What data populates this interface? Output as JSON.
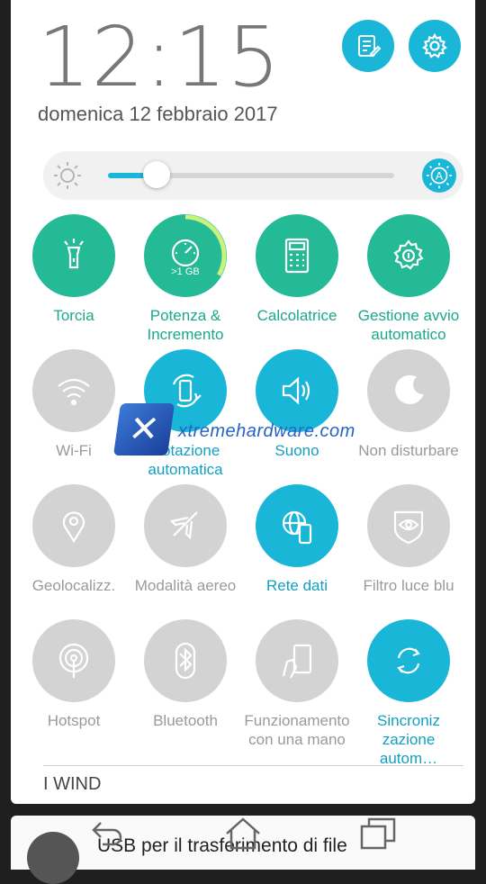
{
  "clock": "12:15",
  "date": "domenica 12 febbraio 2017",
  "header_buttons": [
    {
      "icon": "notes-edit-icon"
    },
    {
      "icon": "settings-gear-icon"
    }
  ],
  "brightness": {
    "level": 0.17,
    "auto": true,
    "auto_label": "A"
  },
  "tiles": [
    {
      "label": "Torcia",
      "state": "on-green",
      "icon": "flashlight-icon"
    },
    {
      "label": "Potenza & Incremento",
      "state": "on-green",
      "icon": "boost-gauge-icon",
      "badge": ">1 GB"
    },
    {
      "label": "Calcolatrice",
      "state": "on-green",
      "icon": "calculator-icon"
    },
    {
      "label": "Gestione avvio automatico",
      "state": "on-green",
      "icon": "auto-start-gear-icon"
    },
    {
      "label": "Wi-Fi",
      "state": "off",
      "icon": "wifi-icon"
    },
    {
      "label": "Rotazione automatica",
      "state": "on-blue",
      "icon": "auto-rotate-icon"
    },
    {
      "label": "Suono",
      "state": "on-blue",
      "icon": "speaker-icon"
    },
    {
      "label": "Non disturbare",
      "state": "off",
      "icon": "moon-icon"
    },
    {
      "label": "Geolocalizz.",
      "state": "off",
      "icon": "location-pin-icon"
    },
    {
      "label": "Modalità aereo",
      "state": "off",
      "icon": "airplane-icon"
    },
    {
      "label": "Rete dati",
      "state": "on-blue",
      "icon": "mobile-data-globe-icon"
    },
    {
      "label": "Filtro luce blu",
      "state": "off",
      "icon": "eye-shield-icon"
    },
    {
      "label": "Hotspot",
      "state": "off",
      "icon": "hotspot-icon"
    },
    {
      "label": "Bluetooth",
      "state": "off",
      "icon": "bluetooth-icon"
    },
    {
      "label": "Funzionamento con una mano",
      "state": "off",
      "icon": "one-hand-icon"
    },
    {
      "label": "Sincroniz zazione autom…",
      "state": "on-blue",
      "icon": "sync-icon"
    }
  ],
  "carrier": "I WIND",
  "notification": {
    "text": "USB per il trasferimento di file",
    "icon": "android-icon"
  },
  "watermark": "xtremehardware.com",
  "nav": [
    {
      "icon": "back-icon"
    },
    {
      "icon": "home-icon"
    },
    {
      "icon": "recents-icon"
    }
  ],
  "colors": {
    "accent_blue": "#1ab6d8",
    "accent_green": "#24ba96",
    "off_gray": "#d3d3d3"
  }
}
